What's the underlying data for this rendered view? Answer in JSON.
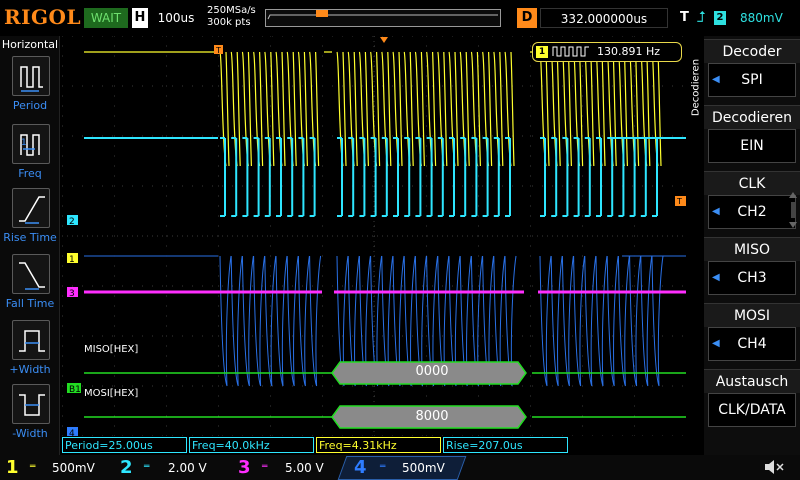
{
  "header": {
    "logo": "RIGOL",
    "run_status": "WAIT",
    "horizontal_mark": "H",
    "timebase": "100us",
    "sample_rate": "250MSa/s",
    "memory_depth": "300k pts",
    "trigger_pos_mark": "T",
    "delay_mark": "D",
    "delay_value": "332.000000us",
    "trigger_mark": "T",
    "trigger_edge_icon": "rising-edge-icon",
    "trigger_source": "2",
    "trigger_level": "880mV"
  },
  "left_panel": {
    "title": "Horizontal",
    "items": [
      {
        "label": "Period",
        "icon": "period-icon"
      },
      {
        "label": "Freq",
        "icon": "frequency-icon"
      },
      {
        "label": "Rise Time",
        "icon": "rise-time-icon"
      },
      {
        "label": "Fall Time",
        "icon": "fall-time-icon"
      },
      {
        "label": "+Width",
        "icon": "positive-width-icon"
      },
      {
        "label": "-Width",
        "icon": "negative-width-icon"
      }
    ]
  },
  "waveform": {
    "freq_counter": {
      "channel": "1",
      "value": "130.891 Hz"
    },
    "bus_names": {
      "miso": "MISO[HEX]",
      "mosi": "MOSI[HEX]"
    },
    "bus_values": {
      "miso": "0000",
      "mosi": "8000"
    },
    "channel_markers": [
      "2",
      "1",
      "3",
      "B1",
      "4"
    ],
    "trigger_marker": "T",
    "trigger_level_marker": "T",
    "colors": {
      "ch1": "#ffff2e",
      "ch2": "#2ee6ff",
      "ch3": "#ff2eff",
      "ch4": "#2e7cff",
      "bus": "#22dd22",
      "trigger": "#ff8a1a"
    }
  },
  "menu": {
    "tab_label": "Decodieren",
    "groups": [
      {
        "header": "Decoder",
        "value": "SPI",
        "arrow": true
      },
      {
        "header": "Decodieren",
        "value": "EIN",
        "arrow": false
      },
      {
        "header": "CLK",
        "value": "CH2",
        "arrow": true
      },
      {
        "header": "MISO",
        "value": "CH3",
        "arrow": true
      },
      {
        "header": "MOSI",
        "value": "CH4",
        "arrow": true
      },
      {
        "header": "Austausch",
        "value": "CLK/DATA",
        "arrow": false
      }
    ]
  },
  "measurements": [
    {
      "text": "Period=25.00us",
      "color": "#2ee6ff"
    },
    {
      "text": "Freq=40.0kHz",
      "color": "#2ee6ff"
    },
    {
      "text": "Freq=4.31kHz",
      "color": "#ffff2e"
    },
    {
      "text": "Rise=207.0us",
      "color": "#2ee6ff"
    }
  ],
  "channels": [
    {
      "num": "1",
      "coupling": "═",
      "scale": "500mV",
      "color": "#ffff2e"
    },
    {
      "num": "2",
      "coupling": "═",
      "scale": "2.00 V",
      "color": "#2ee6ff"
    },
    {
      "num": "3",
      "coupling": "═",
      "scale": "5.00 V",
      "color": "#ff2eff"
    },
    {
      "num": "4",
      "coupling": "═",
      "scale": "500mV",
      "color": "#2e7cff"
    }
  ],
  "speaker_icon": "speaker-muted-icon"
}
